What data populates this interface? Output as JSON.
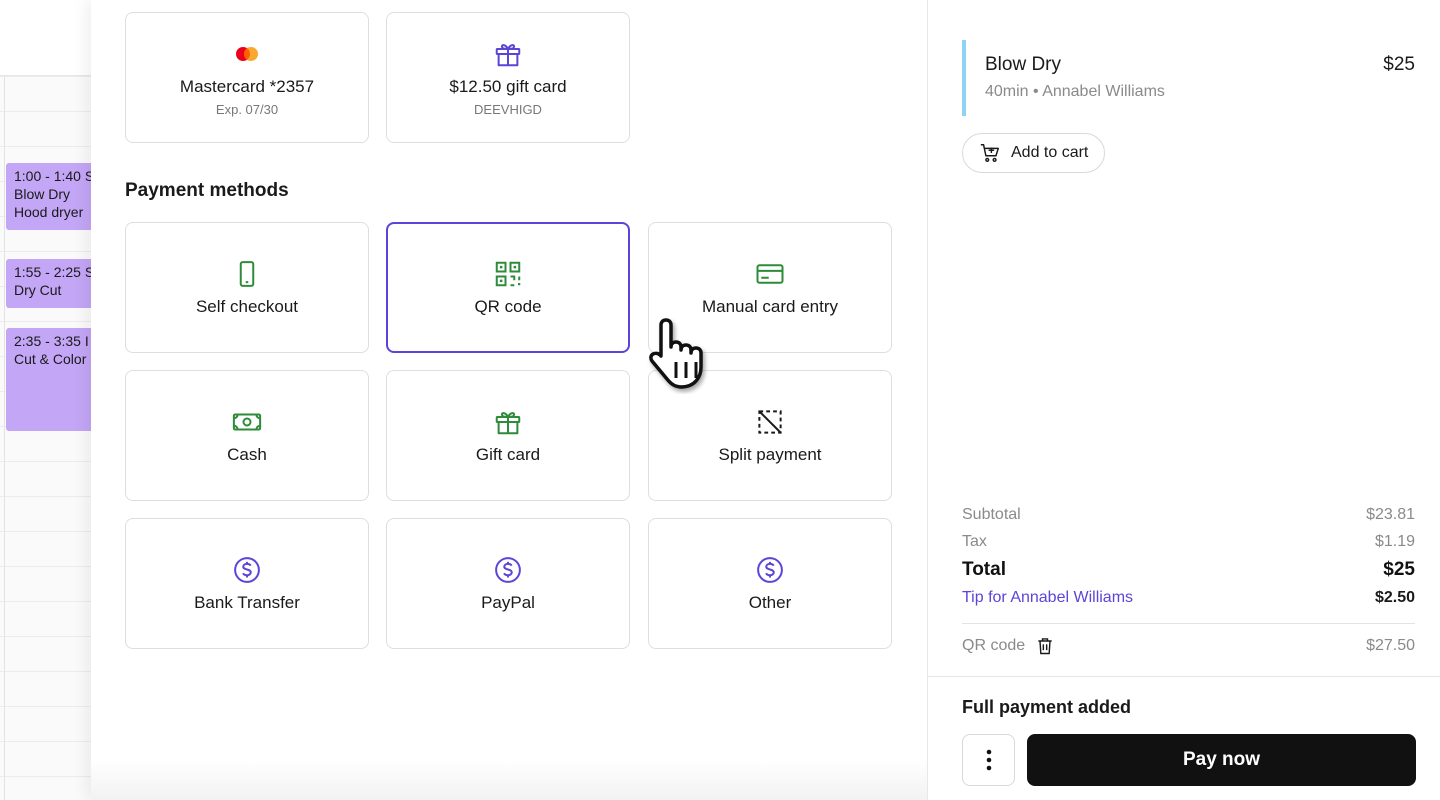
{
  "calendar": {
    "events": [
      {
        "time": "1:00 - 1:40 S",
        "lines": [
          "Blow Dry",
          "Hood dryer"
        ]
      },
      {
        "time": "1:55 - 2:25 S",
        "lines": [
          "Dry Cut"
        ]
      },
      {
        "time": "2:35 - 3:35 I",
        "lines": [
          "Cut & Color"
        ]
      }
    ]
  },
  "saved_methods": [
    {
      "label": "Mastercard *2357",
      "sub": "Exp. 07/30",
      "icon": "mastercard-icon"
    },
    {
      "label": "$12.50 gift card",
      "sub": "DEEVHIGD",
      "icon": "gift-icon"
    }
  ],
  "payment_methods": {
    "title": "Payment methods",
    "items": [
      {
        "label": "Self checkout",
        "icon": "phone-icon"
      },
      {
        "label": "QR code",
        "icon": "qr-code-icon",
        "selected": true
      },
      {
        "label": "Manual card entry",
        "icon": "card-icon"
      },
      {
        "label": "Cash",
        "icon": "cash-icon"
      },
      {
        "label": "Gift card",
        "icon": "gift-icon"
      },
      {
        "label": "Split payment",
        "icon": "split-icon"
      },
      {
        "label": "Bank Transfer",
        "icon": "dollar-icon"
      },
      {
        "label": "PayPal",
        "icon": "dollar-icon"
      },
      {
        "label": "Other",
        "icon": "dollar-icon"
      }
    ]
  },
  "cart": {
    "service": {
      "name": "Blow Dry",
      "meta": "40min • Annabel Williams",
      "price": "$25"
    },
    "add_to_cart": "Add to cart"
  },
  "summary": {
    "subtotal_label": "Subtotal",
    "subtotal": "$23.81",
    "tax_label": "Tax",
    "tax": "$1.19",
    "total_label": "Total",
    "total": "$25",
    "tip_label": "Tip for Annabel Williams",
    "tip": "$2.50"
  },
  "payment_added": {
    "method": "QR code",
    "amount": "$27.50"
  },
  "footer": {
    "status": "Full payment added",
    "pay_label": "Pay now"
  },
  "colors": {
    "accent": "#5b45d8",
    "green": "#2e8b3a",
    "event": "#c3a6f6",
    "service_bar": "#8fd3f4"
  }
}
